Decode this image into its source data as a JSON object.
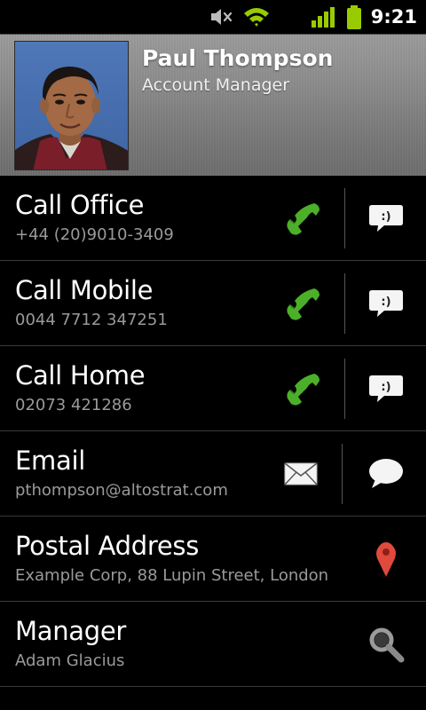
{
  "status_bar": {
    "time": "9:21",
    "icons": [
      "muted-icon",
      "wifi-icon",
      "signal-icon",
      "battery-icon"
    ],
    "accent_color": "#99cc00"
  },
  "contact": {
    "name": "Paul Thompson",
    "title": "Account Manager"
  },
  "rows": [
    {
      "label": "Call Office",
      "value": "+44 (20)9010-3409",
      "primary_icon": "phone-icon",
      "secondary_icon": "sms-icon"
    },
    {
      "label": "Call Mobile",
      "value": "0044 7712 347251",
      "primary_icon": "phone-icon",
      "secondary_icon": "sms-icon"
    },
    {
      "label": "Call Home",
      "value": "02073 421286",
      "primary_icon": "phone-icon",
      "secondary_icon": "sms-icon"
    },
    {
      "label": "Email",
      "value": "pthompson@altostrat.com",
      "primary_icon": "envelope-icon",
      "secondary_icon": "chat-icon"
    },
    {
      "label": "Postal Address",
      "value": "Example Corp, 88 Lupin Street, London",
      "primary_icon": "map-pin-icon"
    },
    {
      "label": "Manager",
      "value": "Adam Glacius",
      "primary_icon": "search-icon"
    }
  ],
  "colors": {
    "phone_green": "#4caf2a",
    "map_pin_red": "#e04a3c",
    "secondary_text": "#9a9a9a"
  }
}
